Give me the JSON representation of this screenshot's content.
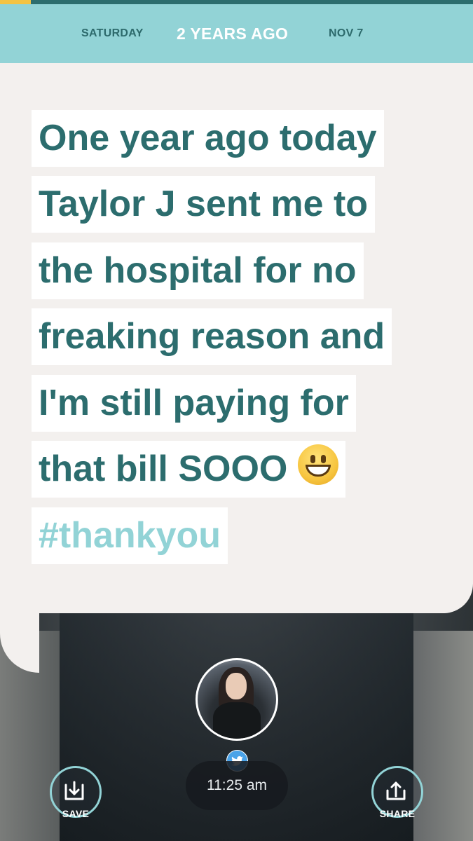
{
  "header": {
    "day": "SATURDAY",
    "relative_time": "2 YEARS AGO",
    "date": "NOV 7"
  },
  "tweet": {
    "lines": [
      "One year ago today",
      "Taylor J sent me to",
      "the hospital for no",
      "freaking reason and",
      "I'm still paying for",
      "that bill SOOO"
    ],
    "emoji": "grinning-face",
    "hashtag": "#thankyou"
  },
  "source_icon": "twitter-bird-icon",
  "time": "11:25 am",
  "actions": {
    "save_label": "SAVE",
    "share_label": "SHARE"
  },
  "colors": {
    "header_bg": "#92d3d6",
    "teal_text": "#2c6d6e",
    "accent_yellow": "#f3c344",
    "bubble_bg": "#f3f0ee",
    "twitter_blue": "#4aa3e8"
  }
}
